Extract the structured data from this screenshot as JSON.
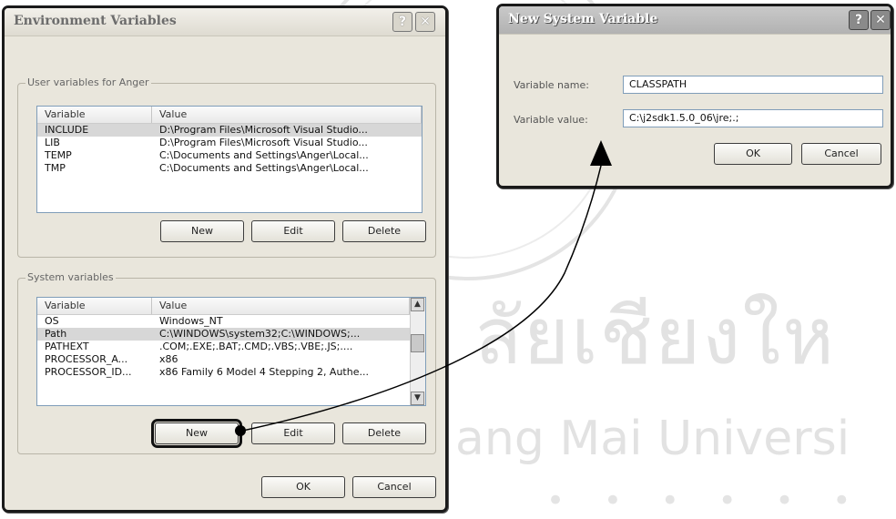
{
  "env_dialog": {
    "title": "Environment Variables",
    "help_btn": "?",
    "close_btn": "✕",
    "user_group_label": "User variables for Anger",
    "user_columns": [
      "Variable",
      "Value"
    ],
    "user_rows": [
      {
        "variable": "INCLUDE",
        "value": "D:\\Program Files\\Microsoft Visual Studio..."
      },
      {
        "variable": "LIB",
        "value": "D:\\Program Files\\Microsoft Visual Studio..."
      },
      {
        "variable": "TEMP",
        "value": "C:\\Documents and Settings\\Anger\\Local..."
      },
      {
        "variable": "TMP",
        "value": "C:\\Documents and Settings\\Anger\\Local..."
      }
    ],
    "user_buttons": {
      "new": "New",
      "edit": "Edit",
      "delete": "Delete"
    },
    "system_group_label": "System variables",
    "system_columns": [
      "Variable",
      "Value"
    ],
    "system_rows": [
      {
        "variable": "OS",
        "value": "Windows_NT"
      },
      {
        "variable": "Path",
        "value": "C:\\WINDOWS\\system32;C:\\WINDOWS;..."
      },
      {
        "variable": "PATHEXT",
        "value": ".COM;.EXE;.BAT;.CMD;.VBS;.VBE;.JS;...."
      },
      {
        "variable": "PROCESSOR_A...",
        "value": "x86"
      },
      {
        "variable": "PROCESSOR_ID...",
        "value": "x86 Family 6 Model 4 Stepping 2, Authe..."
      }
    ],
    "system_buttons": {
      "new": "New",
      "edit": "Edit",
      "delete": "Delete"
    },
    "ok": "OK",
    "cancel": "Cancel"
  },
  "new_dialog": {
    "title": "New System Variable",
    "help_btn": "?",
    "close_btn": "✕",
    "name_label": "Variable name:",
    "name_value": "CLASSPATH",
    "value_label": "Variable value:",
    "value_value": "C:\\j2sdk1.5.0_06\\jre;.;",
    "ok": "OK",
    "cancel": "Cancel"
  },
  "watermark": {
    "thai": "ลัยเชียงให",
    "english": "ang Mai Universi"
  }
}
